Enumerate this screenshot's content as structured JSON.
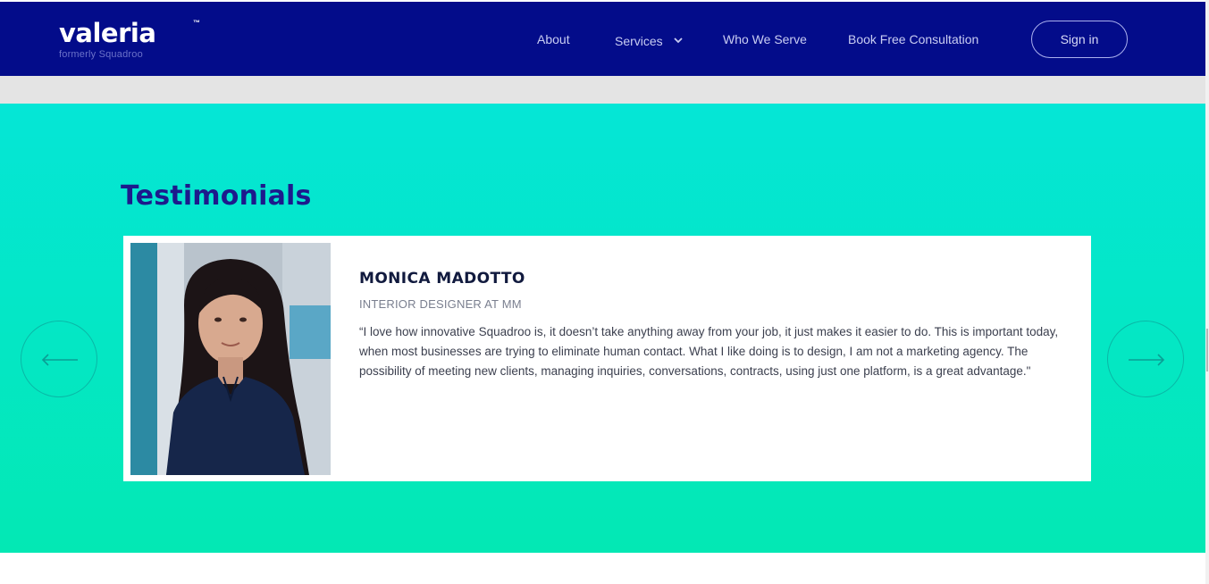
{
  "brand": {
    "name": "valeria",
    "trademark": "™",
    "subtitle": "formerly Squadroo"
  },
  "nav": {
    "items": [
      {
        "label": "About"
      },
      {
        "label": "Services",
        "has_dropdown": true
      },
      {
        "label": "Who We Serve"
      },
      {
        "label": "Book Free Consultation"
      }
    ],
    "signin_label": "Sign in"
  },
  "testimonials": {
    "title": "Testimonials",
    "current": {
      "name": "MONICA MADOTTO",
      "role": "INTERIOR DESIGNER AT MM",
      "quote": "“I love how innovative Squadroo is, it doesn’t take anything away from your job, it just makes it easier to do. This is important today, when most businesses are trying to eliminate human contact. What I like doing is to design, I am not a marketing agency. The possibility of meeting new clients, managing inquiries, conversations, contracts, using just one platform, is a great advantage.\""
    },
    "prev_icon": "arrow-left-icon",
    "next_icon": "arrow-right-icon"
  },
  "colors": {
    "nav_bg": "#030c8a",
    "hero_top": "#05e6d6",
    "hero_bottom": "#03e8b4",
    "title": "#1d1a8c"
  }
}
